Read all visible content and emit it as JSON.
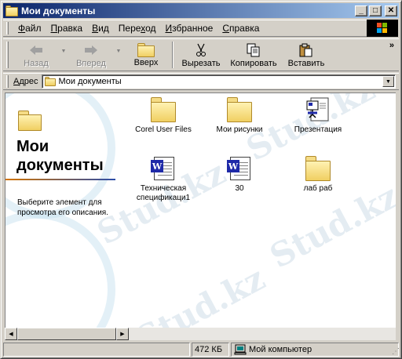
{
  "window": {
    "title": "Мои документы",
    "controls": {
      "minimize": "_",
      "maximize": "□",
      "close": "✕"
    }
  },
  "menu": {
    "items": [
      {
        "accel": "Ф",
        "rest": "айл"
      },
      {
        "accel": "П",
        "rest": "равка"
      },
      {
        "accel": "В",
        "rest": "ид"
      },
      {
        "pre": "Пере",
        "accel": "х",
        "rest": "од"
      },
      {
        "accel": "И",
        "rest": "збранное"
      },
      {
        "accel": "С",
        "rest": "правка"
      }
    ]
  },
  "toolbar": {
    "back_label": "Назад",
    "forward_label": "Вперед",
    "up_label": "Вверх",
    "cut_label": "Вырезать",
    "copy_label": "Копировать",
    "paste_label": "Вставить",
    "more": "»"
  },
  "address": {
    "label_accel": "А",
    "label_rest": "дрес",
    "value": "Мои документы"
  },
  "left_panel": {
    "title_line1": "Мои",
    "title_line2": "документы",
    "description": "Выберите элемент для просмотра его описания."
  },
  "files": [
    {
      "name": "Corel User Files",
      "icon": "folder-icon"
    },
    {
      "name": "Мои рисунки",
      "icon": "folder-icon"
    },
    {
      "name": "Презентация",
      "icon": "presentation-icon"
    },
    {
      "name_line1": "Техническая",
      "name_line2": "спецификаци1",
      "icon": "word-doc-icon"
    },
    {
      "name": "30",
      "icon": "word-doc-icon"
    },
    {
      "name": "лаб раб",
      "icon": "folder-icon"
    }
  ],
  "watermark": "Stud.kz",
  "status": {
    "size": "472 КБ",
    "location": "Мой компьютер"
  },
  "colors": {
    "title_bar_start": "#0a246a",
    "title_bar_end": "#a6caf0",
    "face": "#d4d0c8",
    "word_blue": "#1f2aa8"
  }
}
